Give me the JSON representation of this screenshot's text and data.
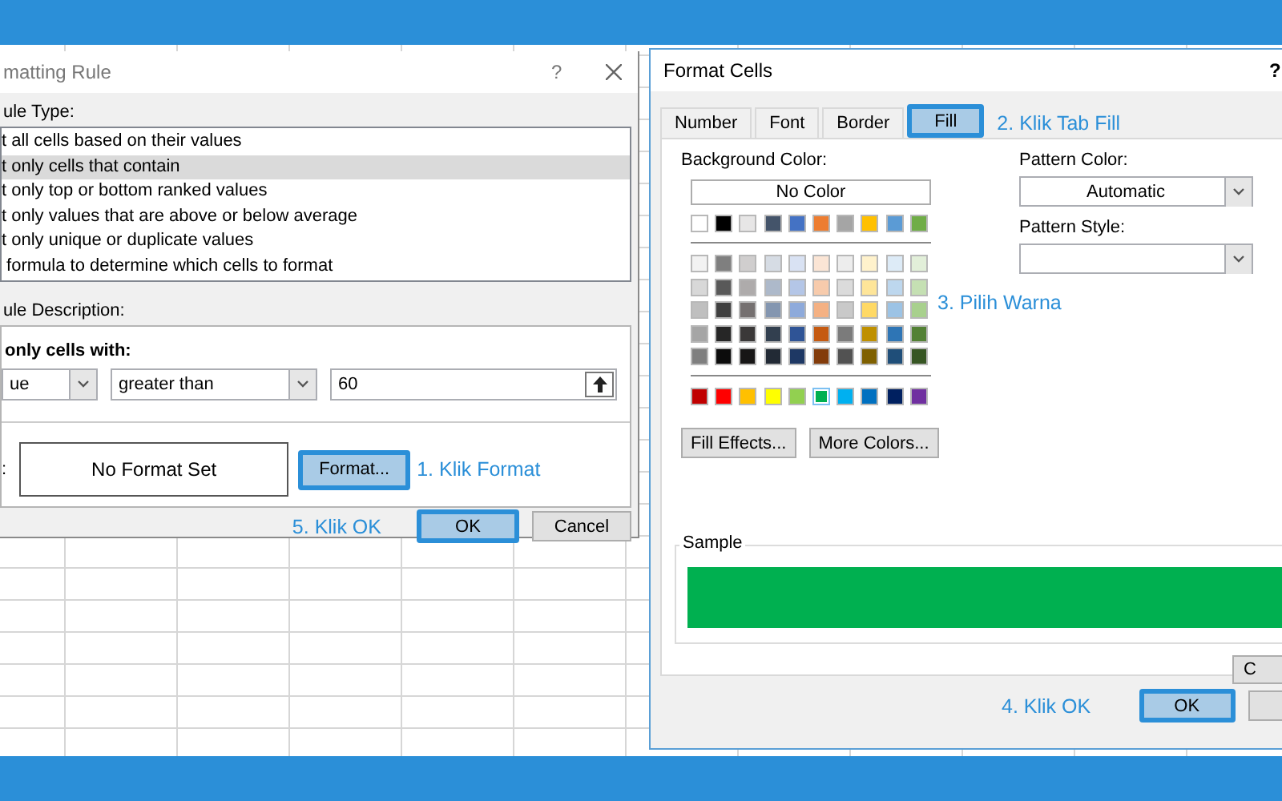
{
  "rule_dialog": {
    "title": "matting Rule",
    "help": "?",
    "rule_type_label": "ule Type:",
    "rule_types": [
      {
        "label": "t all cells based on their values",
        "selected": false
      },
      {
        "label": "t only cells that contain",
        "selected": true
      },
      {
        "label": "t only top or bottom ranked values",
        "selected": false
      },
      {
        "label": "t only values that are above or below average",
        "selected": false
      },
      {
        "label": "t only unique or duplicate values",
        "selected": false
      },
      {
        "label": " formula to determine which cells to format",
        "selected": false
      }
    ],
    "description_label": "ule Description:",
    "condition_heading": "only cells with:",
    "condition_fields": [
      {
        "kind": "dropdown",
        "value": "ue"
      },
      {
        "kind": "dropdown",
        "value": "greater than"
      },
      {
        "kind": "reference",
        "value": "60"
      }
    ],
    "preview_label": ":",
    "preview_text": "No Format Set",
    "format_button": {
      "label": "Format...",
      "highlighted": true
    },
    "format_note": "1. Klik Format",
    "ok_note": "5. Klik OK",
    "buttons": [
      {
        "label": "OK",
        "highlighted": true
      },
      {
        "label": "Cancel",
        "highlighted": false
      }
    ]
  },
  "format_dialog": {
    "title": "Format Cells",
    "help": "?",
    "tabs": [
      {
        "label": "Number",
        "selected": false,
        "highlighted": false
      },
      {
        "label": "Font",
        "selected": false,
        "highlighted": false
      },
      {
        "label": "Border",
        "selected": false,
        "highlighted": false
      },
      {
        "label": "Fill",
        "selected": true,
        "highlighted": true
      }
    ],
    "tab_note": "2. Klik Tab Fill",
    "background_color_label": "Background Color:",
    "no_color_button": "No Color",
    "palette": [
      {
        "kind": "theme",
        "swatches": [
          {
            "color": "#ffffff",
            "selected": false
          },
          {
            "color": "#000000",
            "selected": false
          },
          {
            "color": "#e7e6e6",
            "selected": false
          },
          {
            "color": "#44546a",
            "selected": false
          },
          {
            "color": "#4472c4",
            "selected": false
          },
          {
            "color": "#ed7d31",
            "selected": false
          },
          {
            "color": "#a5a5a5",
            "selected": false
          },
          {
            "color": "#ffc000",
            "selected": false
          },
          {
            "color": "#5b9bd5",
            "selected": false
          },
          {
            "color": "#70ad47",
            "selected": false
          }
        ]
      },
      {
        "kind": "tint",
        "swatches": [
          {
            "color": "#f2f2f2",
            "selected": false
          },
          {
            "color": "#7f7f7f",
            "selected": false
          },
          {
            "color": "#d0cece",
            "selected": false
          },
          {
            "color": "#d6dce4",
            "selected": false
          },
          {
            "color": "#d9e2f3",
            "selected": false
          },
          {
            "color": "#fbe5d5",
            "selected": false
          },
          {
            "color": "#ededed",
            "selected": false
          },
          {
            "color": "#fff2cc",
            "selected": false
          },
          {
            "color": "#ddebf7",
            "selected": false
          },
          {
            "color": "#e2efd9",
            "selected": false
          }
        ]
      },
      {
        "kind": "tint",
        "swatches": [
          {
            "color": "#d8d8d8",
            "selected": false
          },
          {
            "color": "#595959",
            "selected": false
          },
          {
            "color": "#aeabab",
            "selected": false
          },
          {
            "color": "#adb9ca",
            "selected": false
          },
          {
            "color": "#b4c6e7",
            "selected": false
          },
          {
            "color": "#f7cbac",
            "selected": false
          },
          {
            "color": "#dbdbdb",
            "selected": false
          },
          {
            "color": "#fee599",
            "selected": false
          },
          {
            "color": "#bdd7ee",
            "selected": false
          },
          {
            "color": "#c5e0b3",
            "selected": false
          }
        ]
      },
      {
        "kind": "tint",
        "swatches": [
          {
            "color": "#bfbfbf",
            "selected": false
          },
          {
            "color": "#3f3f3f",
            "selected": false
          },
          {
            "color": "#757070",
            "selected": false
          },
          {
            "color": "#8496b0",
            "selected": false
          },
          {
            "color": "#8eaadb",
            "selected": false
          },
          {
            "color": "#f4b183",
            "selected": false
          },
          {
            "color": "#c9c9c9",
            "selected": false
          },
          {
            "color": "#ffd965",
            "selected": false
          },
          {
            "color": "#9cc3e5",
            "selected": false
          },
          {
            "color": "#a8d08d",
            "selected": false
          }
        ]
      },
      {
        "kind": "tint",
        "swatches": [
          {
            "color": "#a5a5a5",
            "selected": false
          },
          {
            "color": "#262626",
            "selected": false
          },
          {
            "color": "#3a3838",
            "selected": false
          },
          {
            "color": "#323f4f",
            "selected": false
          },
          {
            "color": "#2f5496",
            "selected": false
          },
          {
            "color": "#c55a11",
            "selected": false
          },
          {
            "color": "#7b7b7b",
            "selected": false
          },
          {
            "color": "#bf9000",
            "selected": false
          },
          {
            "color": "#2e75b5",
            "selected": false
          },
          {
            "color": "#538135",
            "selected": false
          }
        ]
      },
      {
        "kind": "tint",
        "swatches": [
          {
            "color": "#7f7f7f",
            "selected": false
          },
          {
            "color": "#0c0c0c",
            "selected": false
          },
          {
            "color": "#171616",
            "selected": false
          },
          {
            "color": "#222a35",
            "selected": false
          },
          {
            "color": "#1e3864",
            "selected": false
          },
          {
            "color": "#833c0b",
            "selected": false
          },
          {
            "color": "#525252",
            "selected": false
          },
          {
            "color": "#7f6000",
            "selected": false
          },
          {
            "color": "#1f4e79",
            "selected": false
          },
          {
            "color": "#375623",
            "selected": false
          }
        ]
      },
      {
        "kind": "standard",
        "swatches": [
          {
            "color": "#c00000",
            "selected": false
          },
          {
            "color": "#ff0000",
            "selected": false
          },
          {
            "color": "#ffc000",
            "selected": false
          },
          {
            "color": "#ffff00",
            "selected": false
          },
          {
            "color": "#92d050",
            "selected": false
          },
          {
            "color": "#00b050",
            "selected": true
          },
          {
            "color": "#00b0f0",
            "selected": false
          },
          {
            "color": "#0070c0",
            "selected": false
          },
          {
            "color": "#002060",
            "selected": false
          },
          {
            "color": "#7030a0",
            "selected": false
          }
        ]
      }
    ],
    "palette_note": "3. Pilih Warna",
    "effect_buttons": [
      {
        "label": "Fill Effects...",
        "highlighted": false
      },
      {
        "label": "More Colors...",
        "highlighted": false
      }
    ],
    "pattern_color_label": "Pattern Color:",
    "pattern_color_value": "Automatic",
    "pattern_style_label": "Pattern Style:",
    "sample_label": "Sample",
    "clear_button": "C",
    "ok_note": "4. Klik OK",
    "buttons": [
      {
        "kind": "button",
        "label": "OK",
        "highlighted": true
      },
      {
        "kind": "partial",
        "highlighted": false
      }
    ]
  }
}
